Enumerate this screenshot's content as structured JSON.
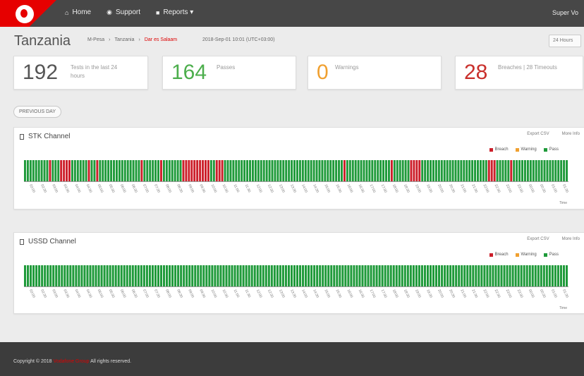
{
  "nav": {
    "items": [
      {
        "icon": "home-icon",
        "glyph": "⌂",
        "label": "Home"
      },
      {
        "icon": "support-icon",
        "glyph": "◉",
        "label": "Support"
      },
      {
        "icon": "reports-icon",
        "glyph": "■",
        "label": "Reports ▾"
      }
    ],
    "user": "Super Vo"
  },
  "page": {
    "title": "Tanzania",
    "breadcrumb": [
      "M-Pesa",
      "Tanzania",
      "Dar es Salaam"
    ],
    "timestamp": "2018-Sep-01 10:01 (UTC+03:00)",
    "range": "24 Hours"
  },
  "stats": {
    "tests": {
      "value": "192",
      "label": "Tests in the last 24 hours",
      "color": "#555555"
    },
    "passes": {
      "value": "164",
      "label": "Passes",
      "color": "#4cae4c"
    },
    "warnings": {
      "value": "0",
      "label": "Warnings",
      "color": "#f0a030"
    },
    "breaches": {
      "value": "28",
      "label": "Breaches | 28 Timeouts",
      "color": "#c9302c"
    }
  },
  "previous_day": "PREVIOUS DAY",
  "panels": {
    "stk": {
      "title": "STK Channel",
      "export": "Export CSV",
      "more": "More Info",
      "time_label": "Time"
    },
    "ussd": {
      "title": "USSD Channel",
      "export": "Export CSV",
      "more": "More Info",
      "time_label": "Time"
    }
  },
  "legend": {
    "breach": "Breach",
    "warning": "Warning",
    "pass": "Pass"
  },
  "colors": {
    "breach": "#cc1f2a",
    "warning": "#f0a030",
    "pass": "#1f9a3a"
  },
  "footer": {
    "prefix": "Copyright © 2018",
    "brand": "Vodafone Group",
    "suffix": "All rights reserved."
  },
  "chart_data": [
    {
      "type": "bar",
      "name": "STK Channel",
      "status_sequence": [
        "P",
        "P",
        "P",
        "P",
        "P",
        "P",
        "P",
        "P",
        "P",
        "B",
        "P",
        "P",
        "P",
        "B",
        "B",
        "B",
        "B",
        "P",
        "P",
        "P",
        "P",
        "P",
        "P",
        "B",
        "P",
        "P",
        "B",
        "P",
        "P",
        "P",
        "P",
        "P",
        "P",
        "P",
        "P",
        "P",
        "P",
        "P",
        "P",
        "P",
        "P",
        "P",
        "B",
        "P",
        "P",
        "P",
        "P",
        "P",
        "P",
        "B",
        "P",
        "P",
        "P",
        "P",
        "P",
        "P",
        "P",
        "B",
        "B",
        "B",
        "B",
        "B",
        "B",
        "B",
        "B",
        "B",
        "B",
        "P",
        "P",
        "B",
        "B",
        "B",
        "P",
        "P",
        "P",
        "P",
        "P",
        "P",
        "P",
        "P",
        "P",
        "P",
        "P",
        "P",
        "P",
        "P",
        "P",
        "P",
        "P",
        "P",
        "P",
        "P",
        "P",
        "P",
        "P",
        "P",
        "P",
        "P",
        "P",
        "P",
        "P",
        "P",
        "P",
        "P",
        "P",
        "P",
        "P",
        "P",
        "P",
        "P",
        "P",
        "P",
        "P",
        "P",
        "P",
        "B",
        "P",
        "P",
        "P",
        "P",
        "P",
        "P",
        "P",
        "P",
        "P",
        "P",
        "P",
        "P",
        "P",
        "P",
        "P",
        "P",
        "B",
        "P",
        "P",
        "P",
        "P",
        "P",
        "P",
        "B",
        "B",
        "B",
        "B",
        "P",
        "P",
        "P",
        "P",
        "P",
        "P",
        "P",
        "P",
        "P",
        "P",
        "P",
        "P",
        "P",
        "P",
        "P",
        "P",
        "P",
        "P",
        "P",
        "P",
        "P",
        "P",
        "P",
        "P",
        "B",
        "B",
        "B",
        "P",
        "P",
        "P",
        "P",
        "P",
        "B",
        "P",
        "P",
        "P",
        "P",
        "P",
        "P",
        "P",
        "P",
        "P",
        "P",
        "P",
        "P",
        "P",
        "P",
        "P",
        "P",
        "P",
        "P",
        "P",
        "P"
      ],
      "categories": [
        "02:00",
        "02:30",
        "03:00",
        "03:30",
        "04:00",
        "04:30",
        "05:00",
        "05:30",
        "06:00",
        "06:30",
        "07:00",
        "07:30",
        "08:00",
        "08:30",
        "09:00",
        "09:30",
        "10:00",
        "10:30",
        "11:00",
        "11:30",
        "12:00",
        "12:30",
        "13:00",
        "13:30",
        "14:00",
        "14:30",
        "15:00",
        "15:30",
        "16:00",
        "16:30",
        "17:00",
        "17:30",
        "18:00",
        "18:30",
        "19:00",
        "19:30",
        "20:00",
        "20:30",
        "21:00",
        "21:30",
        "22:00",
        "22:30",
        "23:00",
        "23:30",
        "00:00",
        "00:30",
        "01:00",
        "01:30"
      ],
      "legend": [
        "Breach",
        "Warning",
        "Pass"
      ],
      "xlabel": "Time"
    },
    {
      "type": "bar",
      "name": "USSD Channel",
      "status_sequence_all": "P",
      "count": 192,
      "categories": [
        "02:00",
        "02:30",
        "03:00",
        "03:30",
        "04:00",
        "04:30",
        "05:00",
        "05:30",
        "06:00",
        "06:30",
        "07:00",
        "07:30",
        "08:00",
        "08:30",
        "09:00",
        "09:30",
        "10:00",
        "10:30",
        "11:00",
        "11:30",
        "12:00",
        "12:30",
        "13:00",
        "13:30",
        "14:00",
        "14:30",
        "15:00",
        "15:30",
        "16:00",
        "16:30",
        "17:00",
        "17:30",
        "18:00",
        "18:30",
        "19:00",
        "19:30",
        "20:00",
        "20:30",
        "21:00",
        "21:30",
        "22:00",
        "22:30",
        "23:00",
        "23:30",
        "00:00",
        "00:30",
        "01:00",
        "01:30"
      ],
      "legend": [
        "Breach",
        "Warning",
        "Pass"
      ],
      "xlabel": "Time"
    }
  ]
}
